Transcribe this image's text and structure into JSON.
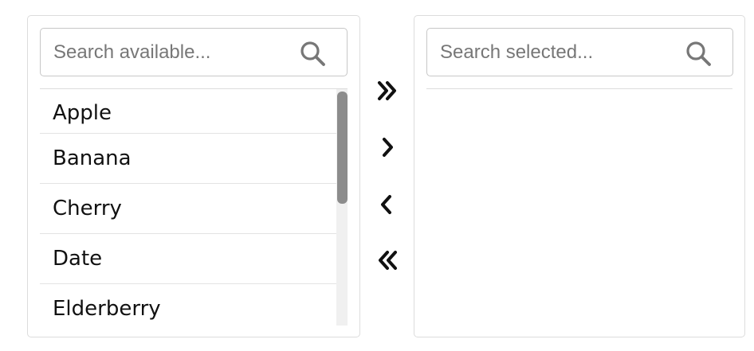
{
  "available": {
    "search": {
      "placeholder": "Search available...",
      "icon": "search-icon"
    },
    "items": [
      "Apple",
      "Banana",
      "Cherry",
      "Date",
      "Elderberry"
    ]
  },
  "selected": {
    "search": {
      "placeholder": "Search selected...",
      "icon": "search-icon"
    },
    "items": []
  },
  "controls": {
    "move_all_right": {
      "icon": "double-chevron-right-icon"
    },
    "move_right": {
      "icon": "chevron-right-icon"
    },
    "move_left": {
      "icon": "chevron-left-icon"
    },
    "move_all_left": {
      "icon": "double-chevron-left-icon"
    }
  },
  "colors": {
    "border": "#dcdcdc",
    "search_border": "#c7c7c7",
    "scroll_thumb": "#8c8c8c",
    "scroll_track": "#f0f0f0",
    "placeholder": "#777777",
    "icon": "#777777"
  }
}
